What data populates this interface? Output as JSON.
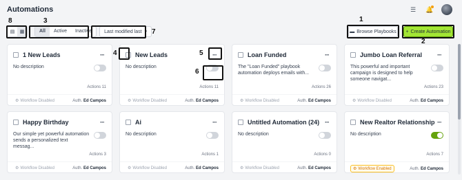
{
  "header": {
    "title": "Automations",
    "icons": [
      "list-settings-icon",
      "bell-icon",
      "user-avatar"
    ]
  },
  "toolbar": {
    "filters": [
      "All",
      "Active",
      "Inactive"
    ],
    "sort_label": "Last modified last",
    "browse_label": "Browse Playbooks",
    "create_label": "Create Automation"
  },
  "annotations": [
    "1",
    "2",
    "3",
    "4",
    "5",
    "6",
    "7",
    "8"
  ],
  "cards": [
    {
      "title": "1 New Leads",
      "desc": "No description",
      "toggle_on": false,
      "actions": "Actions 11",
      "status": "Workflow Disabled",
      "author_prefix": "Auth.",
      "author": "Ed Campos"
    },
    {
      "title": "New Leads",
      "desc": "No description",
      "toggle_on": false,
      "actions": "Actions 11",
      "status": "Workflow Disabled",
      "author_prefix": "Auth.",
      "author": "Ed Campos"
    },
    {
      "title": "Loan Funded",
      "desc": "The \"Loan Funded\" playbook automation deploys emails with...",
      "toggle_on": false,
      "actions": "Actions 26",
      "status": "Workflow Disabled",
      "author_prefix": "Auth.",
      "author": "Ed Campos"
    },
    {
      "title": "Jumbo Loan Referral",
      "desc": "This powerful and important campaign is designed to help someone navigat...",
      "toggle_on": false,
      "actions": "Actions 23",
      "status": "Workflow Disabled",
      "author_prefix": "Auth.",
      "author": "Ed Campos"
    },
    {
      "title": "Happy Birthday",
      "desc": "Our simple yet powerful automation sends a personalized text messag...",
      "toggle_on": false,
      "actions": "Actions 3",
      "status": "Workflow Disabled",
      "author_prefix": "Auth.",
      "author": "Ed Campos"
    },
    {
      "title": "Ai",
      "desc": "No description",
      "toggle_on": false,
      "actions": "Actions 1",
      "status": "Workflow Disabled",
      "author_prefix": "Auth.",
      "author": "Ed Campos"
    },
    {
      "title": "Untitled Automation (24)",
      "desc": "No description",
      "toggle_on": false,
      "actions": "Actions 0",
      "status": "Workflow Disabled",
      "author_prefix": "Auth.",
      "author": "Ed Campos"
    },
    {
      "title": "New Realtor Relationship",
      "desc": "No description",
      "toggle_on": true,
      "actions": "Actions 7",
      "status": "Workflow Enabled",
      "author_prefix": "Auth.",
      "author": "Ed Campos"
    }
  ],
  "colors": {
    "accent": "#a3e635",
    "toggle_on": "#65a30d",
    "enabled": "#d97706"
  }
}
